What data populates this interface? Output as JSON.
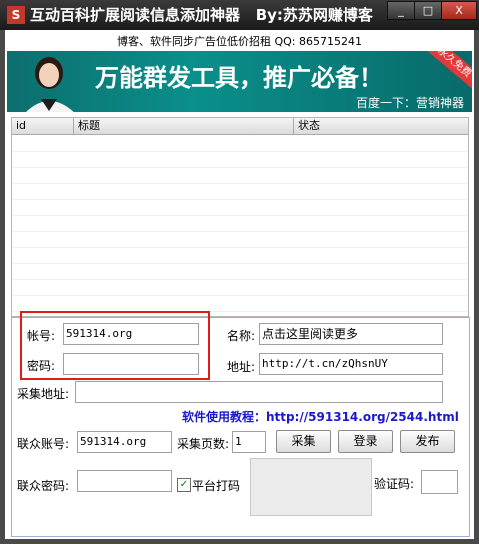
{
  "window": {
    "title": "互动百科扩展阅读信息添加神器",
    "author": "By:苏苏网赚博客",
    "controls": {
      "minimize": "_",
      "maximize": "□",
      "close": "X"
    }
  },
  "ad_text": "博客、软件同步广告位低价招租 QQ: 865715241",
  "banner": {
    "slogan": "万能群发工具，推广必备！",
    "sub": "百度一下：营销神器",
    "ribbon": "永久免费"
  },
  "table": {
    "columns": [
      "id",
      "标题",
      "状态"
    ],
    "rows": []
  },
  "form": {
    "account_label": "帐号:",
    "account_value": "591314.org",
    "password_label": "密码:",
    "password_value": "",
    "name_label": "名称:",
    "name_value": "点击这里阅读更多",
    "address_label": "地址:",
    "address_value": "http://t.cn/zQhsnUY",
    "collect_url_label": "采集地址:",
    "collect_url_value": "",
    "tutorial_text": "软件使用教程：http://591314.org/2544.html",
    "union_account_label": "联众账号:",
    "union_account_value": "591314.org",
    "pages_label": "采集页数:",
    "pages_value": "1",
    "union_password_label": "联众密码:",
    "union_password_value": "",
    "platform_label": "平台打码",
    "platform_checked": true,
    "captcha_label": "验证码:",
    "captcha_value": ""
  },
  "buttons": {
    "collect": "采集",
    "login": "登录",
    "publish": "发布"
  }
}
